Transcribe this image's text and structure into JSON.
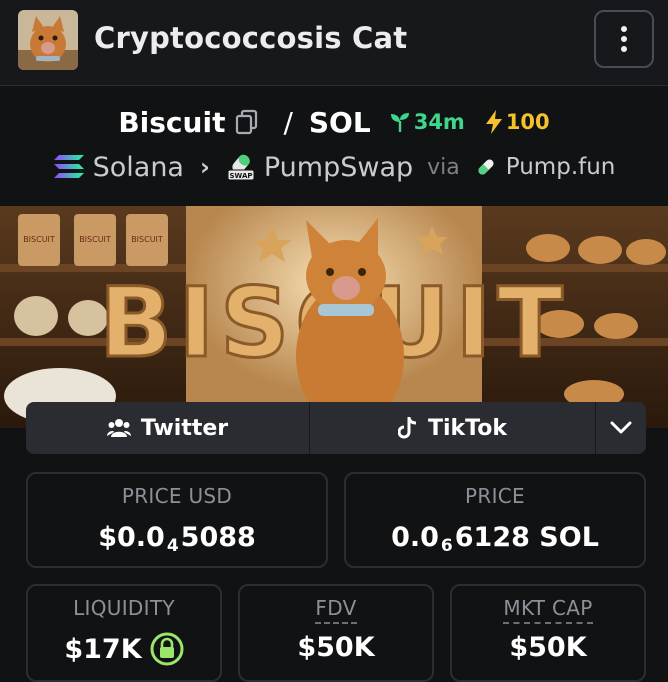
{
  "header": {
    "title": "Cryptococcosis Cat",
    "menu_icon": "kebab-menu-icon"
  },
  "pair": {
    "base": "Biscuit",
    "separator": "/",
    "quote": "SOL",
    "age": "34m",
    "boosts": "100"
  },
  "chain": {
    "name": "Solana",
    "dex": "PumpSwap",
    "via": "via",
    "launchpad": "Pump.fun"
  },
  "banner": {
    "text": "BISCUIT",
    "jar_label": "BISCUIT"
  },
  "socials": [
    {
      "label": "Twitter",
      "icon": "users-icon"
    },
    {
      "label": "TikTok",
      "icon": "tiktok-icon"
    }
  ],
  "stats": {
    "price_usd": {
      "label": "PRICE USD",
      "prefix": "$0.0",
      "zeros": "4",
      "digits": "5088"
    },
    "price_native": {
      "label": "PRICE",
      "prefix": "0.0",
      "zeros": "6",
      "digits": "6128 SOL"
    },
    "liquidity": {
      "label": "LIQUIDITY",
      "value": "$17K"
    },
    "fdv": {
      "label": "FDV",
      "value": "$50K"
    },
    "mkt_cap": {
      "label": "MKT CAP",
      "value": "$50K"
    }
  },
  "colors": {
    "background": "#111214",
    "card_border": "#2b2d33",
    "age_green": "#3dd68c",
    "boost_yellow": "#f4c22b",
    "lock_green": "#9be56a"
  }
}
